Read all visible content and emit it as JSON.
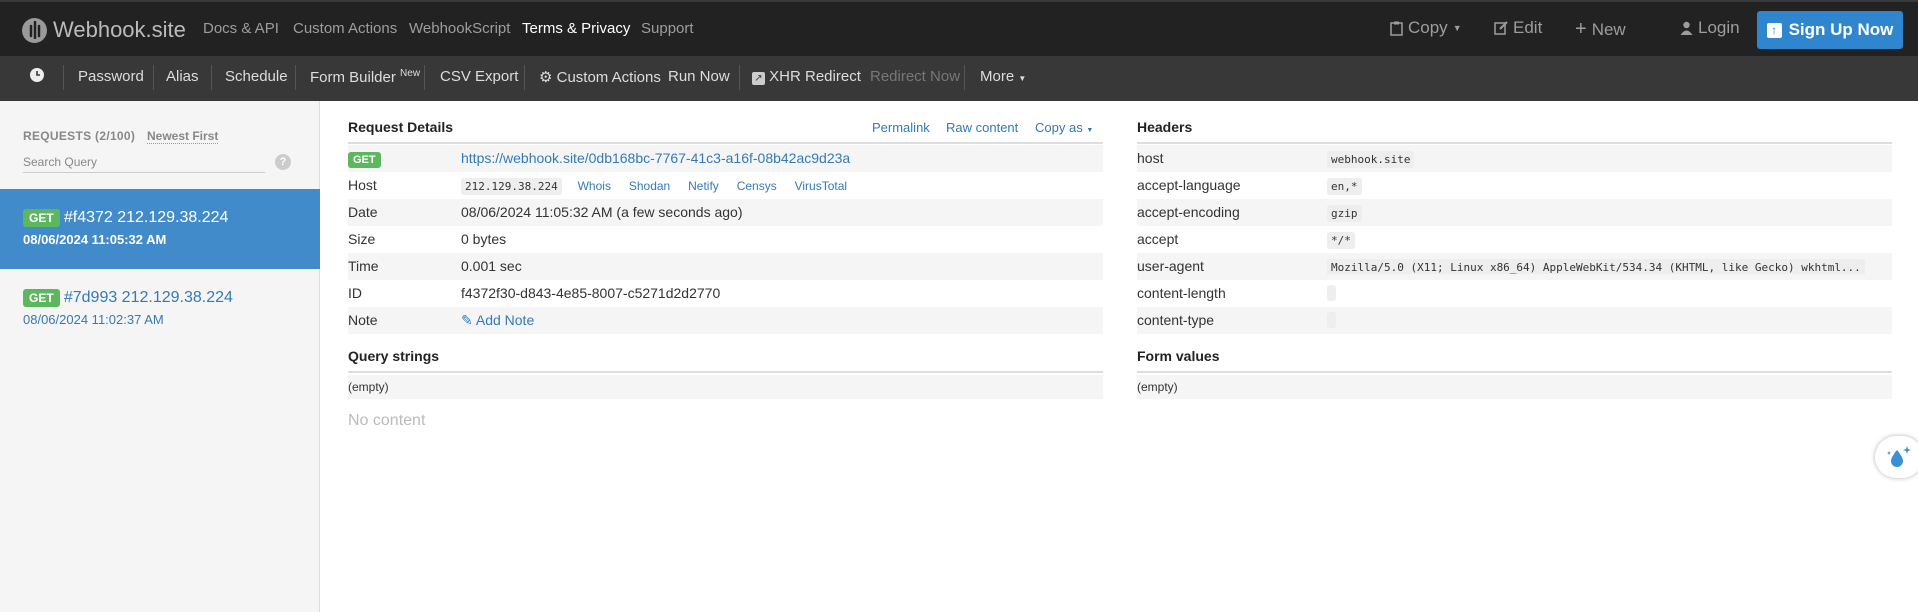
{
  "brand": {
    "name": "Webhook.site"
  },
  "nav": {
    "docs": "Docs & API",
    "custom_actions": "Custom Actions",
    "webhookscript": "WebhookScript",
    "terms": "Terms & Privacy",
    "support": "Support"
  },
  "right_nav": {
    "copy": "Copy",
    "edit": "Edit",
    "new": "New",
    "login": "Login",
    "signup": "Sign Up Now"
  },
  "toolbar": {
    "password": "Password",
    "alias": "Alias",
    "schedule": "Schedule",
    "form_builder": "Form Builder",
    "form_builder_badge": "New",
    "csv_export": "CSV Export",
    "custom_actions": "Custom Actions",
    "run_now": "Run Now",
    "xhr_redirect": "XHR Redirect",
    "redirect_now": "Redirect Now",
    "more": "More"
  },
  "sidebar": {
    "header": "REQUESTS (2/100)",
    "sort": "Newest First",
    "search_placeholder": "Search Query",
    "help": "?",
    "requests": [
      {
        "method": "GET",
        "title": "#f4372 212.129.38.224",
        "date": "08/06/2024 11:05:32 AM",
        "active": true
      },
      {
        "method": "GET",
        "title": "#7d993 212.129.38.224",
        "date": "08/06/2024 11:02:37 AM",
        "active": false
      }
    ]
  },
  "details": {
    "title": "Request Details",
    "permalink": "Permalink",
    "raw": "Raw content",
    "copy_as": "Copy as",
    "method": "GET",
    "url": "https://webhook.site/0db168bc-7767-41c3-a16f-08b42ac9d23a",
    "host_label": "Host",
    "host": "212.129.38.224",
    "host_links": [
      "Whois",
      "Shodan",
      "Netify",
      "Censys",
      "VirusTotal"
    ],
    "date_label": "Date",
    "date": "08/06/2024 11:05:32 AM (a few seconds ago)",
    "size_label": "Size",
    "size": "0 bytes",
    "time_label": "Time",
    "time": "0.001 sec",
    "id_label": "ID",
    "id": "f4372f30-d843-4e85-8007-c5271d2d2770",
    "note_label": "Note",
    "add_note": "Add Note"
  },
  "query": {
    "title": "Query strings",
    "empty": "(empty)",
    "no_content": "No content"
  },
  "headers": {
    "title": "Headers",
    "rows": [
      {
        "key": "host",
        "value": "webhook.site"
      },
      {
        "key": "accept-language",
        "value": "en,*"
      },
      {
        "key": "accept-encoding",
        "value": "gzip"
      },
      {
        "key": "accept",
        "value": "*/*"
      },
      {
        "key": "user-agent",
        "value": "Mozilla/5.0 (X11; Linux x86_64) AppleWebKit/534.34 (KHTML, like Gecko) wkhtml..."
      },
      {
        "key": "content-length",
        "value": ""
      },
      {
        "key": "content-type",
        "value": ""
      }
    ]
  },
  "form": {
    "title": "Form values",
    "empty": "(empty)"
  },
  "colors": {
    "topbar": "#222222",
    "toolbar": "#383838",
    "accent": "#428bca",
    "get": "#5cb85c",
    "signup": "#2f86cf"
  }
}
